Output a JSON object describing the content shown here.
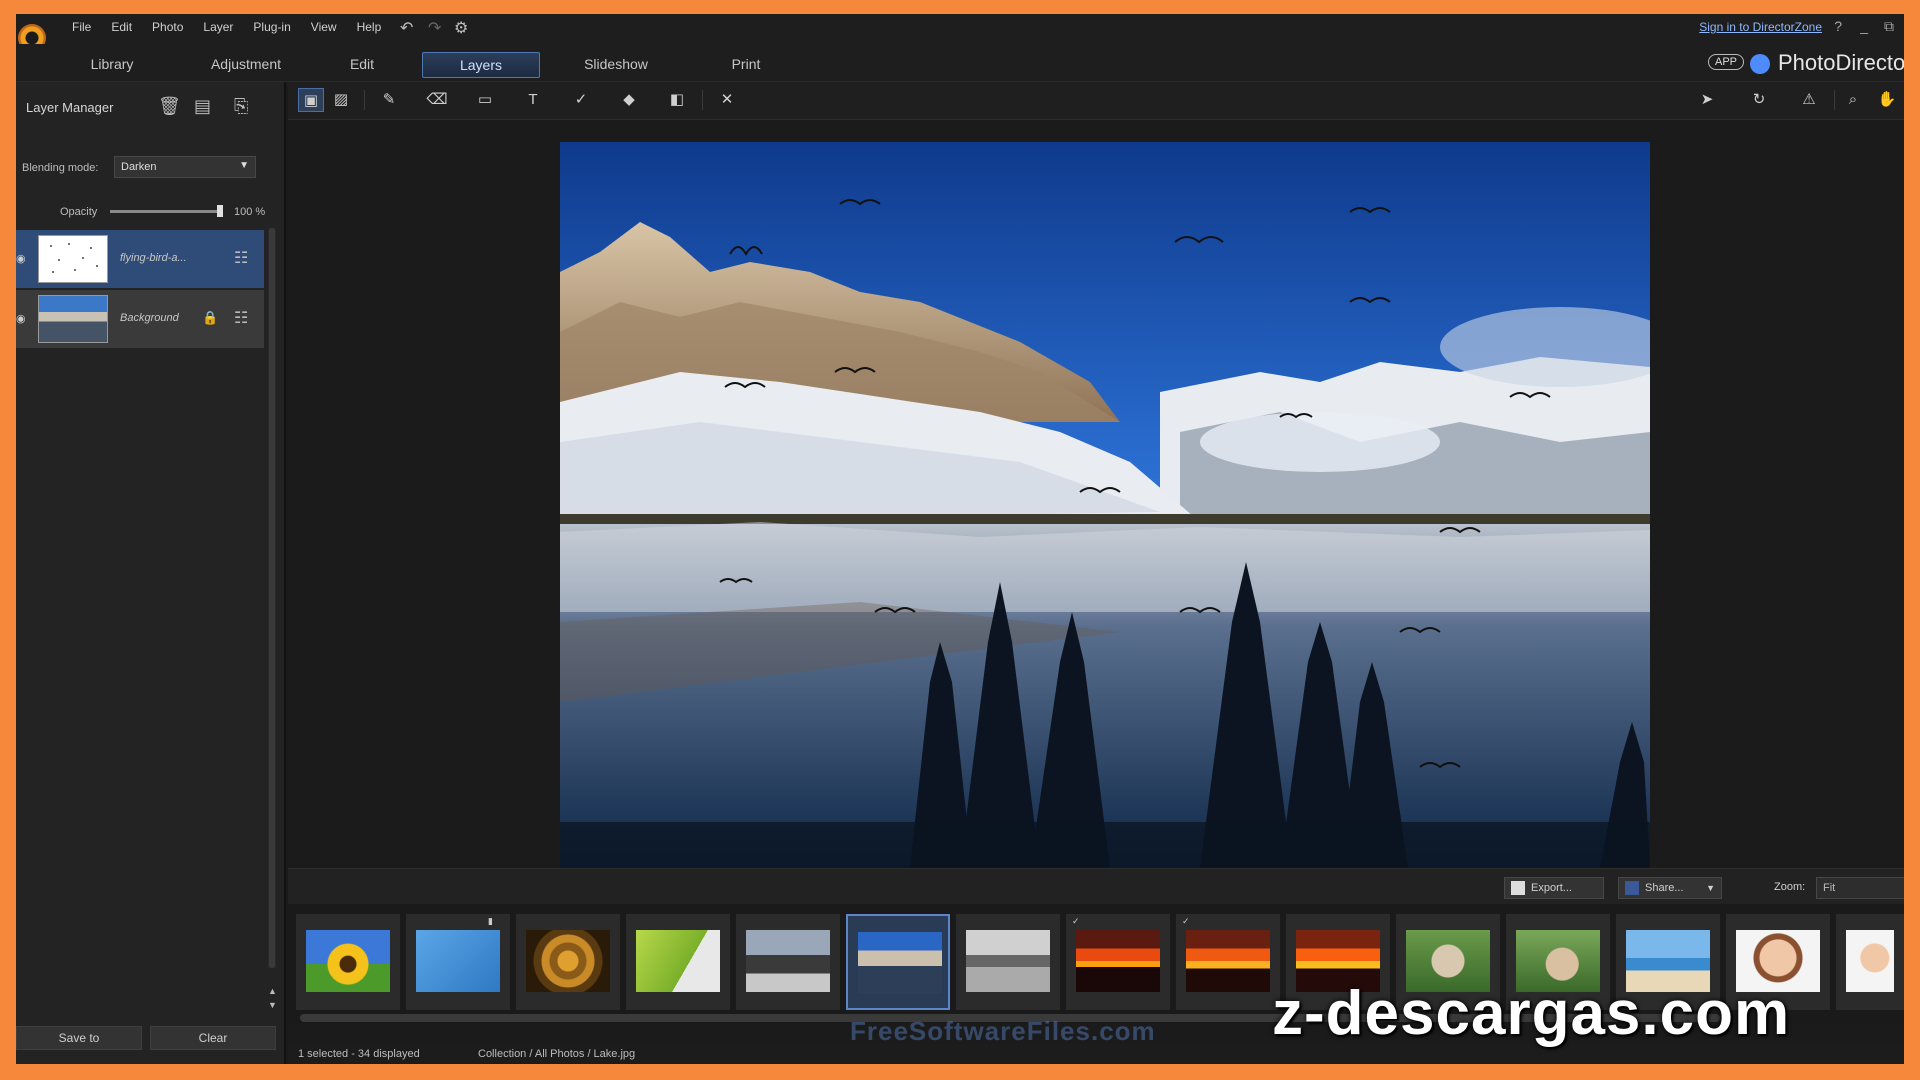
{
  "menu": [
    "File",
    "Edit",
    "Photo",
    "Layer",
    "Plug-in",
    "View",
    "Help"
  ],
  "titlebar": {
    "signin": "Sign in to DirectorZone",
    "help": "?",
    "minimize": "_",
    "restore": "⧉"
  },
  "module_tabs": [
    {
      "label": "Library",
      "active": false
    },
    {
      "label": "Adjustment",
      "active": false
    },
    {
      "label": "Edit",
      "active": false
    },
    {
      "label": "Layers",
      "active": true
    },
    {
      "label": "Slideshow",
      "active": false
    },
    {
      "label": "Print",
      "active": false
    }
  ],
  "brand": {
    "badge": "APP",
    "name": "PhotoDirecto"
  },
  "layer_manager": {
    "title": "Layer Manager",
    "blending_label": "Blending mode:",
    "blending_value": "Darken",
    "opacity_label": "Opacity",
    "opacity_value": "100 %",
    "opacity_fraction": 1.0,
    "layers": [
      {
        "name": "flying-bird-a...",
        "selected": true,
        "locked": false
      },
      {
        "name": "Background",
        "selected": false,
        "locked": true
      }
    ],
    "save_label": "Save to",
    "clear_label": "Clear"
  },
  "strip": {
    "export_label": "Export...",
    "share_label": "Share...",
    "zoom_label": "Zoom:",
    "zoom_value": "Fit"
  },
  "status": {
    "selection": "1 selected - 34 displayed",
    "path": "Collection / All Photos / Lake.jpg"
  },
  "watermarks": {
    "fsf": "FreeSoftwareFiles.com",
    "zd": "z-descargas.com"
  },
  "colors": {
    "accent": "#4e77b5",
    "frame": "#f5883a",
    "selected_layer": "#2f4c78"
  }
}
